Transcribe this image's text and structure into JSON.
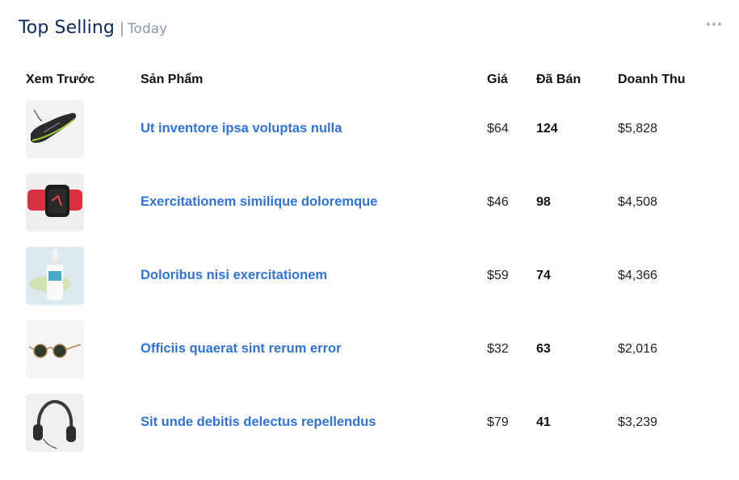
{
  "header": {
    "title": "Top Selling",
    "separator": "|",
    "subtitle": "Today"
  },
  "table": {
    "columns": [
      "Xem Trước",
      "Sản Phẩm",
      "Giá",
      "Đã Bán",
      "Doanh Thu"
    ],
    "rows": [
      {
        "image": "running-shoe",
        "name": "Ut inventore ipsa voluptas nulla",
        "price": "$64",
        "sold": "124",
        "revenue": "$5,828"
      },
      {
        "image": "smartwatch",
        "name": "Exercitationem similique doloremque",
        "price": "$46",
        "sold": "98",
        "revenue": "$4,508"
      },
      {
        "image": "serum-bottle",
        "name": "Doloribus nisi exercitationem",
        "price": "$59",
        "sold": "74",
        "revenue": "$4,366"
      },
      {
        "image": "sunglasses",
        "name": "Officiis quaerat sint rerum error",
        "price": "$32",
        "sold": "63",
        "revenue": "$2,016"
      },
      {
        "image": "headphones",
        "name": "Sit unde debitis delectus repellendus",
        "price": "$79",
        "sold": "41",
        "revenue": "$3,239"
      }
    ]
  },
  "colors": {
    "title": "#0b2a5b",
    "subtitle": "#8a98ad",
    "link": "#2f73d8"
  }
}
